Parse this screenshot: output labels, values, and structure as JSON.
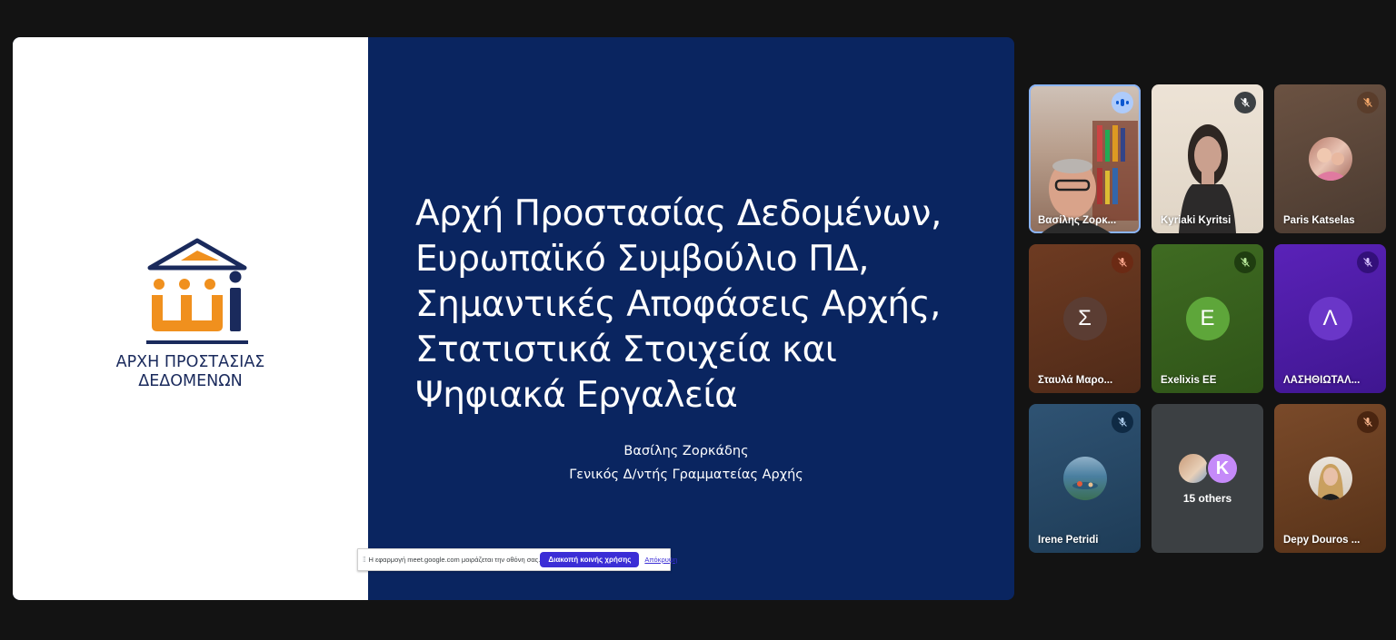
{
  "slide": {
    "logo_line1": "ΑΡΧΗ ΠΡΟΣΤΑΣΙΑΣ",
    "logo_line2": "ΔΕΔΟΜΕΝΩΝ",
    "title_lines": [
      "Αρχή Προστασίας Δεδομένων,",
      "Ευρωπαϊκό Συμβούλιο ΠΔ,",
      "Σημαντικές Αποφάσεις Αρχής,",
      "Στατιστικά Στοιχεία και",
      "Ψηφιακά Εργαλεία"
    ],
    "presenter_name": "Βασίλης Ζορκάδης",
    "presenter_role": "Γενικός Δ/ντής Γραμματείας Αρχής",
    "colors": {
      "slide_bg": "#0a2560",
      "logo_navy": "#1a2a5c",
      "logo_orange": "#f0901e"
    }
  },
  "share_banner": {
    "message": "Η εφαρμογή meet.google.com μοιράζεται την οθόνη σας.",
    "stop_label": "Διακοπή κοινής χρήσης",
    "hide_label": "Απόκρυψη"
  },
  "participants": [
    {
      "name": "Βασίλης Ζορκ...",
      "status": "speaking"
    },
    {
      "name": "Kyriaki Kyritsi",
      "status": "muted"
    },
    {
      "name": "Paris Katselas",
      "status": "muted"
    },
    {
      "name": "Σταυλά Μαρο...",
      "status": "muted",
      "initial": "Σ"
    },
    {
      "name": "Exelixis EE",
      "status": "muted",
      "initial": "E"
    },
    {
      "name": "ΛΑΣΗΘΙΩΤΑΛ...",
      "status": "muted",
      "initial": "Λ"
    },
    {
      "name": "Irene Petridi",
      "status": "muted"
    },
    {
      "name": "15 others",
      "initial_k": "K"
    },
    {
      "name": "Depy Douros ...",
      "status": "muted"
    }
  ]
}
